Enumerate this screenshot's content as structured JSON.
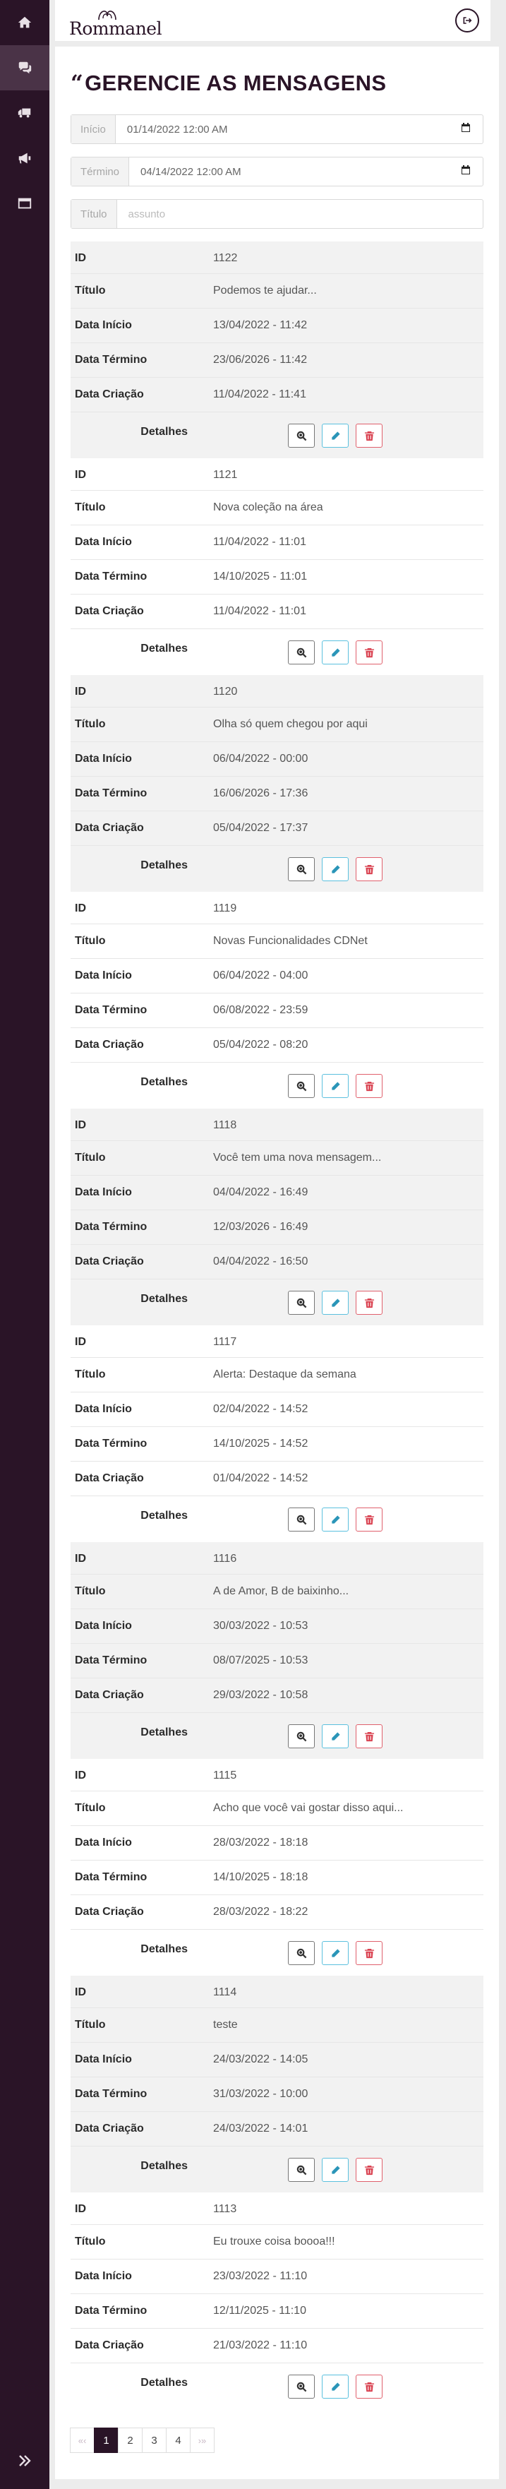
{
  "sidebar": {
    "items": [
      {
        "icon": "home-icon"
      },
      {
        "icon": "chat-icon",
        "active": true
      },
      {
        "icon": "truck-icon"
      },
      {
        "icon": "megaphone-icon"
      },
      {
        "icon": "window-icon"
      }
    ],
    "bottom_icon": "double-chevron-right-icon"
  },
  "header": {
    "logo_text": "Rommanel"
  },
  "page": {
    "title_quote": "“",
    "title": "GERENCIE AS MENSAGENS"
  },
  "filters": {
    "inicio_label": "Início",
    "inicio_value": "01/14/2022 12:00 AM",
    "termino_label": "Término",
    "termino_value": "04/14/2022 12:00 AM",
    "titulo_label": "Título",
    "titulo_placeholder": "assunto"
  },
  "labels": {
    "id": "ID",
    "titulo": "Título",
    "inicio": "Data Início",
    "termino": "Data Término",
    "criacao": "Data Criação",
    "detalhes": "Detalhes"
  },
  "records": [
    {
      "id": "1122",
      "titulo": "Podemos te ajudar...",
      "inicio": "13/04/2022 - 11:42",
      "termino": "23/06/2026 - 11:42",
      "criacao": "11/04/2022 - 11:41"
    },
    {
      "id": "1121",
      "titulo": "Nova coleção na área",
      "inicio": "11/04/2022 - 11:01",
      "termino": "14/10/2025 - 11:01",
      "criacao": "11/04/2022 - 11:01"
    },
    {
      "id": "1120",
      "titulo": "Olha só quem chegou por aqui",
      "inicio": "06/04/2022 - 00:00",
      "termino": "16/06/2026 - 17:36",
      "criacao": "05/04/2022 - 17:37"
    },
    {
      "id": "1119",
      "titulo": "Novas Funcionalidades CDNet",
      "inicio": "06/04/2022 - 04:00",
      "termino": "06/08/2022 - 23:59",
      "criacao": "05/04/2022 - 08:20"
    },
    {
      "id": "1118",
      "titulo": "Você tem uma nova mensagem...",
      "inicio": "04/04/2022 - 16:49",
      "termino": "12/03/2026 - 16:49",
      "criacao": "04/04/2022 - 16:50"
    },
    {
      "id": "1117",
      "titulo": "Alerta: Destaque da semana",
      "inicio": "02/04/2022 - 14:52",
      "termino": "14/10/2025 - 14:52",
      "criacao": "01/04/2022 - 14:52"
    },
    {
      "id": "1116",
      "titulo": "A de Amor, B de baixinho...",
      "inicio": "30/03/2022 - 10:53",
      "termino": "08/07/2025 - 10:53",
      "criacao": "29/03/2022 - 10:58"
    },
    {
      "id": "1115",
      "titulo": "Acho que você vai gostar disso aqui...",
      "inicio": "28/03/2022 - 18:18",
      "termino": "14/10/2025 - 18:18",
      "criacao": "28/03/2022 - 18:22"
    },
    {
      "id": "1114",
      "titulo": "teste",
      "inicio": "24/03/2022 - 14:05",
      "termino": "31/03/2022 - 10:00",
      "criacao": "24/03/2022 - 14:01"
    },
    {
      "id": "1113",
      "titulo": "Eu trouxe coisa boooa!!!",
      "inicio": "23/03/2022 - 11:10",
      "termino": "12/11/2025 - 11:10",
      "criacao": "21/03/2022 - 11:10"
    }
  ],
  "pagination": {
    "first": "«‹",
    "pages": [
      "1",
      "2",
      "3",
      "4"
    ],
    "active": "1",
    "last": "›»"
  }
}
